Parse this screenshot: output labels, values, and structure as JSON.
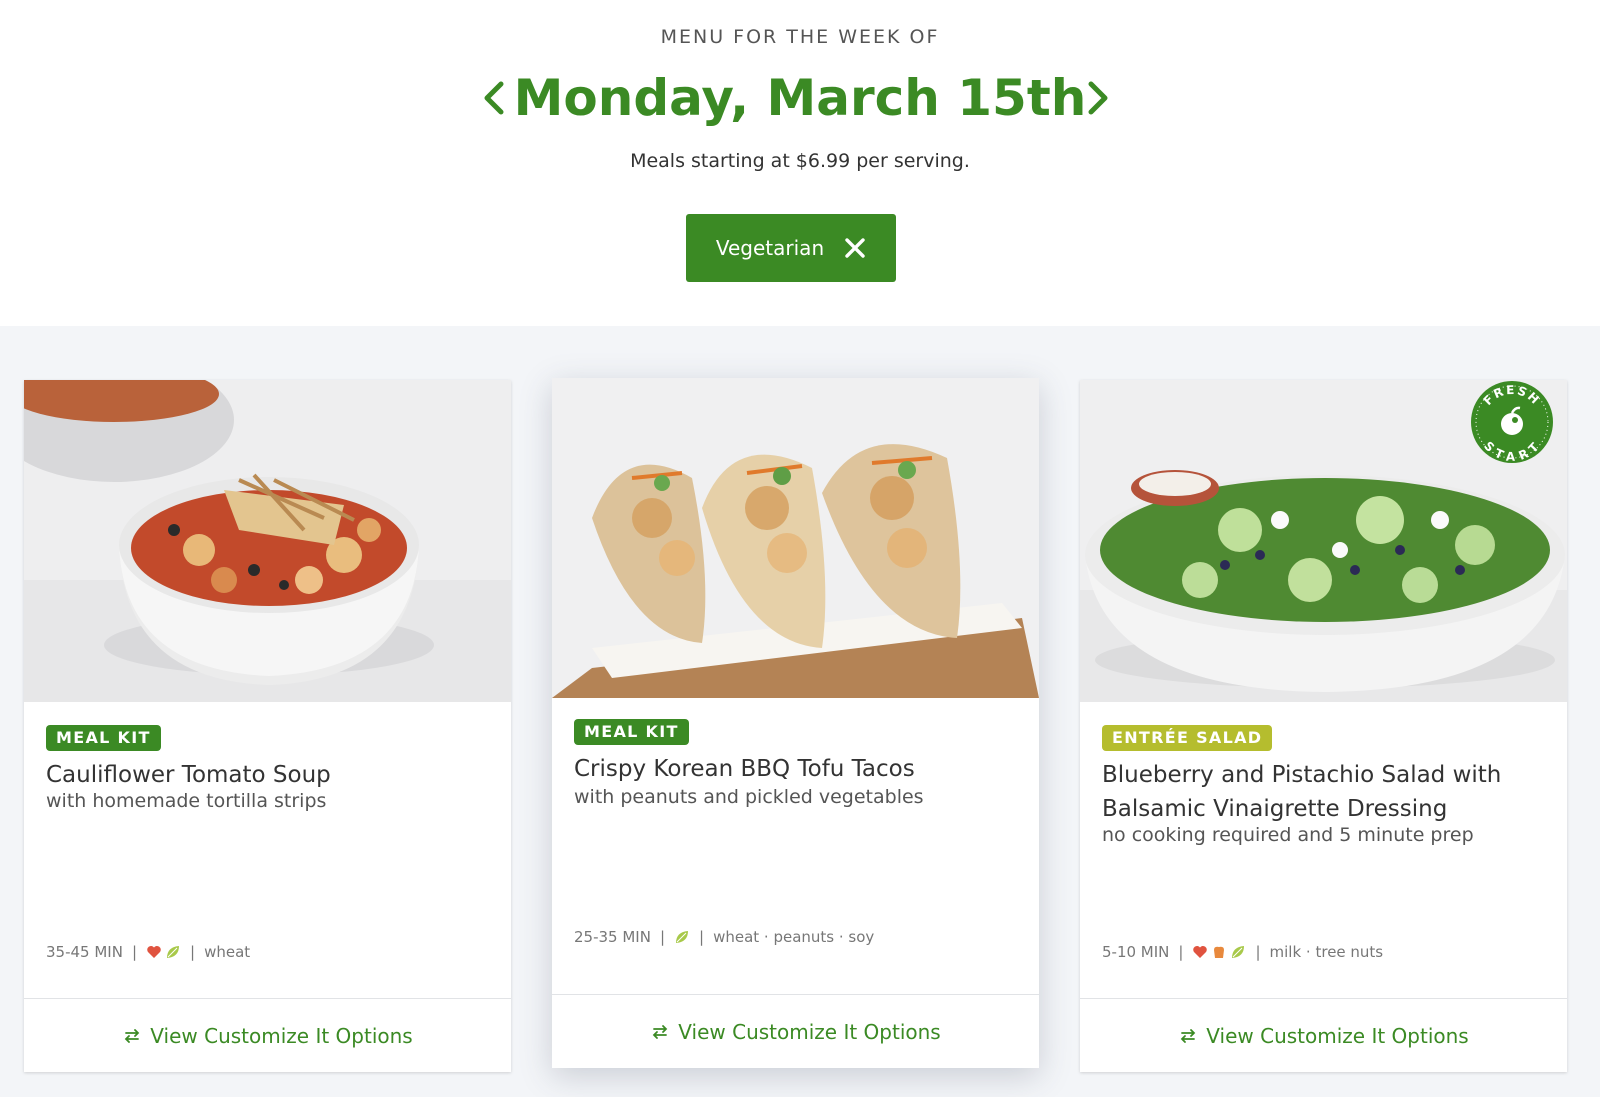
{
  "header": {
    "week_label": "MENU FOR THE WEEK OF",
    "date": "Monday, March 15th",
    "price_line": "Meals starting at $6.99 per serving.",
    "filter_chip": "Vegetarian",
    "accent_color": "#3b8a24"
  },
  "cards": [
    {
      "badge": "MEAL KIT",
      "title": "Cauliflower Tomato Soup",
      "subtitle": "with homemade tortilla strips",
      "time": "35-45 MIN",
      "allergens": "wheat",
      "diet_icons": [
        "heart-icon",
        "leaf-icon"
      ],
      "action": "View Customize It Options"
    },
    {
      "badge": "MEAL KIT",
      "title": "Crispy Korean BBQ Tofu Tacos",
      "subtitle": "with peanuts and pickled vegetables",
      "time": "25-35 MIN",
      "allergens": "wheat · peanuts · soy",
      "diet_icons": [
        "leaf-icon"
      ],
      "action": "View Customize It Options"
    },
    {
      "badge": "ENTRÉE SALAD",
      "title": "Blueberry and Pistachio Salad with Balsamic Vinaigrette Dressing",
      "subtitle": "no cooking required and 5 minute prep",
      "time": "5-10 MIN",
      "allergens": "milk · tree nuts",
      "diet_icons": [
        "heart-icon",
        "carb-icon",
        "leaf-icon"
      ],
      "action": "View Customize It Options"
    }
  ],
  "fresh_start_badge": {
    "top_text": "FRESH",
    "bottom_text": "START"
  }
}
